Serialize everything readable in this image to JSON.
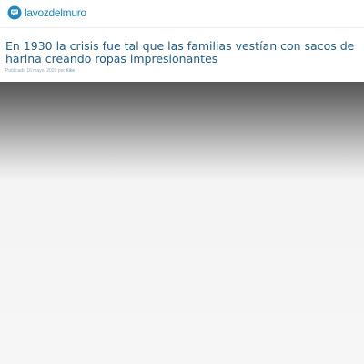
{
  "header": {
    "logo_text": "lavozdelmuro",
    "logo_icon": "speech-bubble-icon",
    "accent_color": "#1e88c7"
  },
  "article": {
    "title": "En 1930 la crisis fue tal que las familias vestían con sacos de harina creando ropas impresionantes",
    "meta_prefix": "Publicado 16 mayo, 2020 por",
    "author": "Kike",
    "title_color": "#1f5c86"
  }
}
